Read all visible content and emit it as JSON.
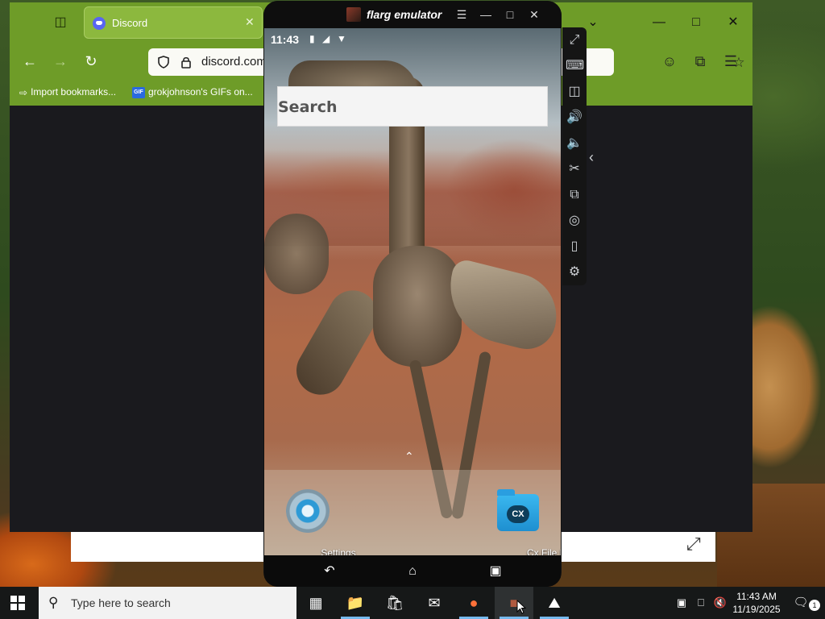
{
  "browser": {
    "tab": {
      "title": "Discord"
    },
    "url": "discord.com/",
    "bookmarks": [
      "Import bookmarks...",
      "grokjohnson's GIFs on..."
    ],
    "theme_color": "#6e9c28"
  },
  "emulator": {
    "title": "flarg emulator",
    "status_time": "11:43",
    "search_placeholder": "Search",
    "apps": [
      {
        "label": "Settings",
        "icon": "settings-gear-icon"
      },
      {
        "label": "Cx File Expl",
        "icon": "cx-folder-icon",
        "badge": "CX"
      }
    ],
    "toolbar": [
      "fullscreen-icon",
      "keyboard-icon",
      "apk-install-icon",
      "volume-up-icon",
      "volume-down-icon",
      "screenshot-cut-icon",
      "multi-instance-icon",
      "location-icon",
      "shake-icon",
      "settings-icon"
    ]
  },
  "taskbar": {
    "search_placeholder": "Type here to search",
    "time": "11:43 AM",
    "date": "11/19/2025",
    "notification_count": "1",
    "apps": [
      "task-view-icon",
      "file-explorer-icon",
      "store-icon",
      "mail-icon",
      "firefox-icon",
      "flarg-emulator-icon",
      "photos-icon"
    ]
  }
}
